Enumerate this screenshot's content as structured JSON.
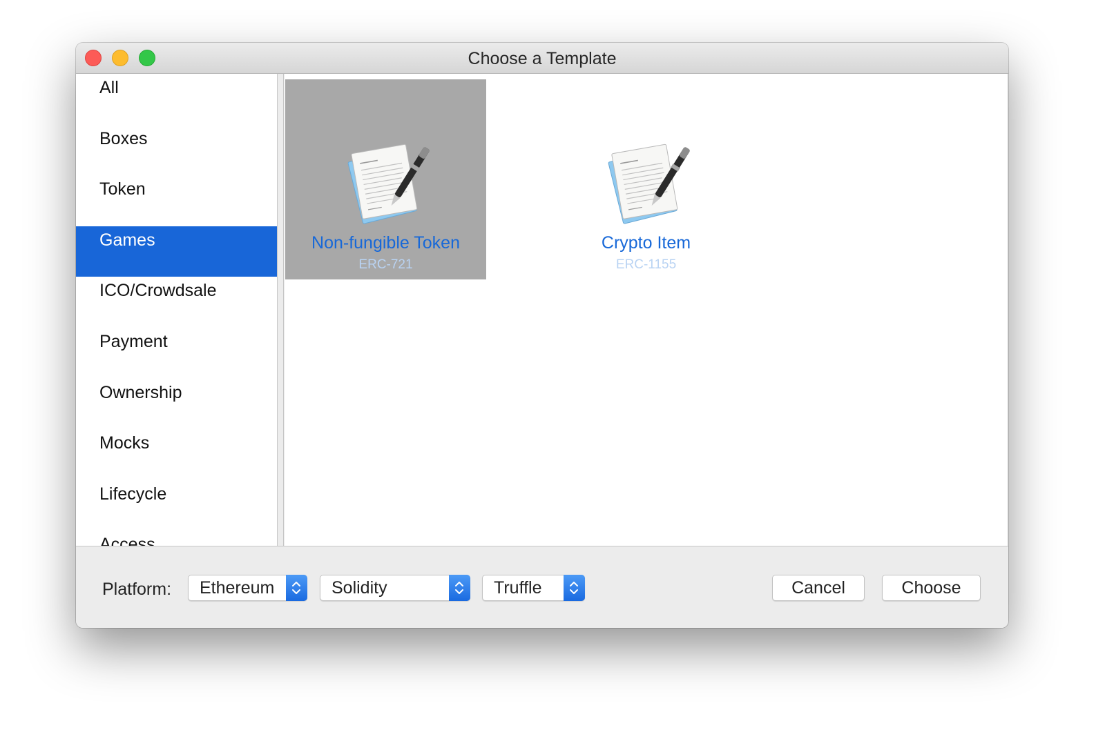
{
  "window": {
    "title": "Choose a Template"
  },
  "traffic_lights": {
    "close": "close-button",
    "minimize": "minimize-button",
    "zoom": "zoom-button"
  },
  "sidebar": {
    "selected": "Games",
    "items": [
      {
        "label": "All"
      },
      {
        "label": "Boxes"
      },
      {
        "label": "Token"
      },
      {
        "label": "Games"
      },
      {
        "label": "ICO/Crowdsale"
      },
      {
        "label": "Payment"
      },
      {
        "label": "Ownership"
      },
      {
        "label": "Mocks"
      },
      {
        "label": "Lifecycle"
      },
      {
        "label": "Access"
      }
    ]
  },
  "templates": [
    {
      "name": "Non-fungible Token",
      "subtitle": "ERC-721",
      "icon": "document-pen-icon",
      "selected": true
    },
    {
      "name": "Crypto Item",
      "subtitle": "ERC-1155",
      "icon": "document-pen-icon",
      "selected": false
    }
  ],
  "footer": {
    "platform_label": "Platform:",
    "platform_value": "Ethereum",
    "language_value": "Solidity",
    "framework_value": "Truffle",
    "cancel_label": "Cancel",
    "choose_label": "Choose"
  },
  "colors": {
    "accent": "#1866d8",
    "selected_tile": "#a8a8a8",
    "template_name": "#1768d8",
    "template_subtitle": "#b9d3f3"
  }
}
